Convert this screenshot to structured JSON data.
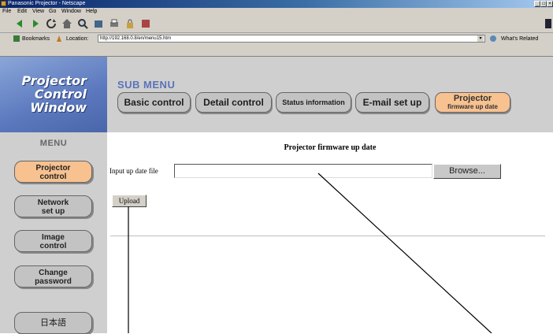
{
  "window": {
    "title": "Panasonic Projector - Netscape"
  },
  "menubar": [
    "File",
    "Edit",
    "View",
    "Go",
    "Window",
    "Help"
  ],
  "location": {
    "bookmarks_label": "Bookmarks",
    "location_label": "Location:",
    "url": "http://192.168.0.8/en/menu15.htm",
    "related_label": "What's Related"
  },
  "logo": {
    "line1": "Projector",
    "line2": "Control",
    "line3": "Window"
  },
  "submenu": {
    "title": "SUB MENU",
    "buttons": [
      {
        "label": "Basic control"
      },
      {
        "label": "Detail control"
      },
      {
        "label": "Status information"
      },
      {
        "label": "E-mail set up"
      }
    ],
    "active_line1": "Projector",
    "active_line2": "firmware up date"
  },
  "menu": {
    "title": "MENU",
    "items": [
      {
        "line1": "Projector",
        "line2": "control"
      },
      {
        "line1": "Network",
        "line2": "set up"
      },
      {
        "line1": "Image",
        "line2": "control"
      },
      {
        "line1": "Change",
        "line2": "password"
      },
      {
        "line1": "日本語",
        "line2": ""
      }
    ]
  },
  "content": {
    "title": "Projector firmware up date",
    "input_label": "Input up date file",
    "input_value": "",
    "browse_label": "Browse...",
    "upload_label": "Upload"
  }
}
